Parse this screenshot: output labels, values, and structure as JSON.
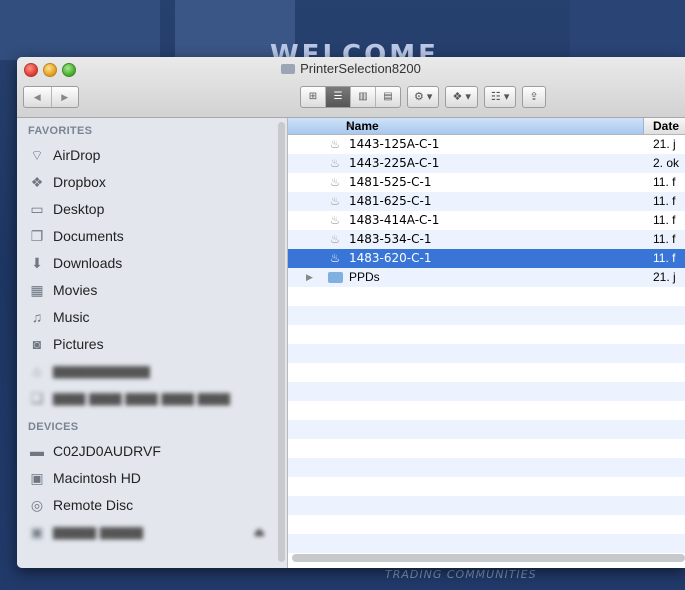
{
  "window": {
    "title": "PrinterSelection8200"
  },
  "background": {
    "welcome_text": "WELCOME",
    "trading_text": "TRADING COMMUNITIES"
  },
  "nav": {
    "back": "◀",
    "forward": "▶"
  },
  "toolbar": {
    "view_buttons": [
      "icon-view",
      "list-view",
      "column-view",
      "coverflow-view"
    ],
    "action_label": "⚙ ▾",
    "dropbox_label": "❖ ▾",
    "arrange_label": "☷ ▾",
    "share_label": "⇪"
  },
  "sidebar": {
    "favorites_header": "FAVORITES",
    "favorites": [
      {
        "label": "AirDrop",
        "icon": "airdrop-icon"
      },
      {
        "label": "Dropbox",
        "icon": "dropbox-icon"
      },
      {
        "label": "Desktop",
        "icon": "desktop-icon"
      },
      {
        "label": "Documents",
        "icon": "documents-icon"
      },
      {
        "label": "Downloads",
        "icon": "downloads-icon"
      },
      {
        "label": "Movies",
        "icon": "movies-icon"
      },
      {
        "label": "Music",
        "icon": "music-icon"
      },
      {
        "label": "Pictures",
        "icon": "pictures-icon"
      }
    ],
    "devices_header": "DEVICES",
    "devices": [
      {
        "label": "C02JD0AUDRVF",
        "icon": "computer-icon"
      },
      {
        "label": "Macintosh HD",
        "icon": "harddisk-icon"
      },
      {
        "label": "Remote Disc",
        "icon": "disc-icon"
      }
    ],
    "eject_label": "⏏"
  },
  "list": {
    "name_header": "Name",
    "date_header": "Date",
    "rows": [
      {
        "name": "1443-125A-C-1",
        "date": "21. j"
      },
      {
        "name": "1443-225A-C-1",
        "date": "2. ok"
      },
      {
        "name": "1481-525-C-1",
        "date": "11. f"
      },
      {
        "name": "1481-625-C-1",
        "date": "11. f"
      },
      {
        "name": "1483-414A-C-1",
        "date": "11. f"
      },
      {
        "name": "1483-534-C-1",
        "date": "11. f"
      },
      {
        "name": "1483-620-C-1",
        "date": "11. f"
      },
      {
        "name": "PPDs",
        "date": "21. j"
      }
    ]
  },
  "colors": {
    "selection": "#3875d7",
    "sidebar_bg": "#e3e7ed"
  }
}
